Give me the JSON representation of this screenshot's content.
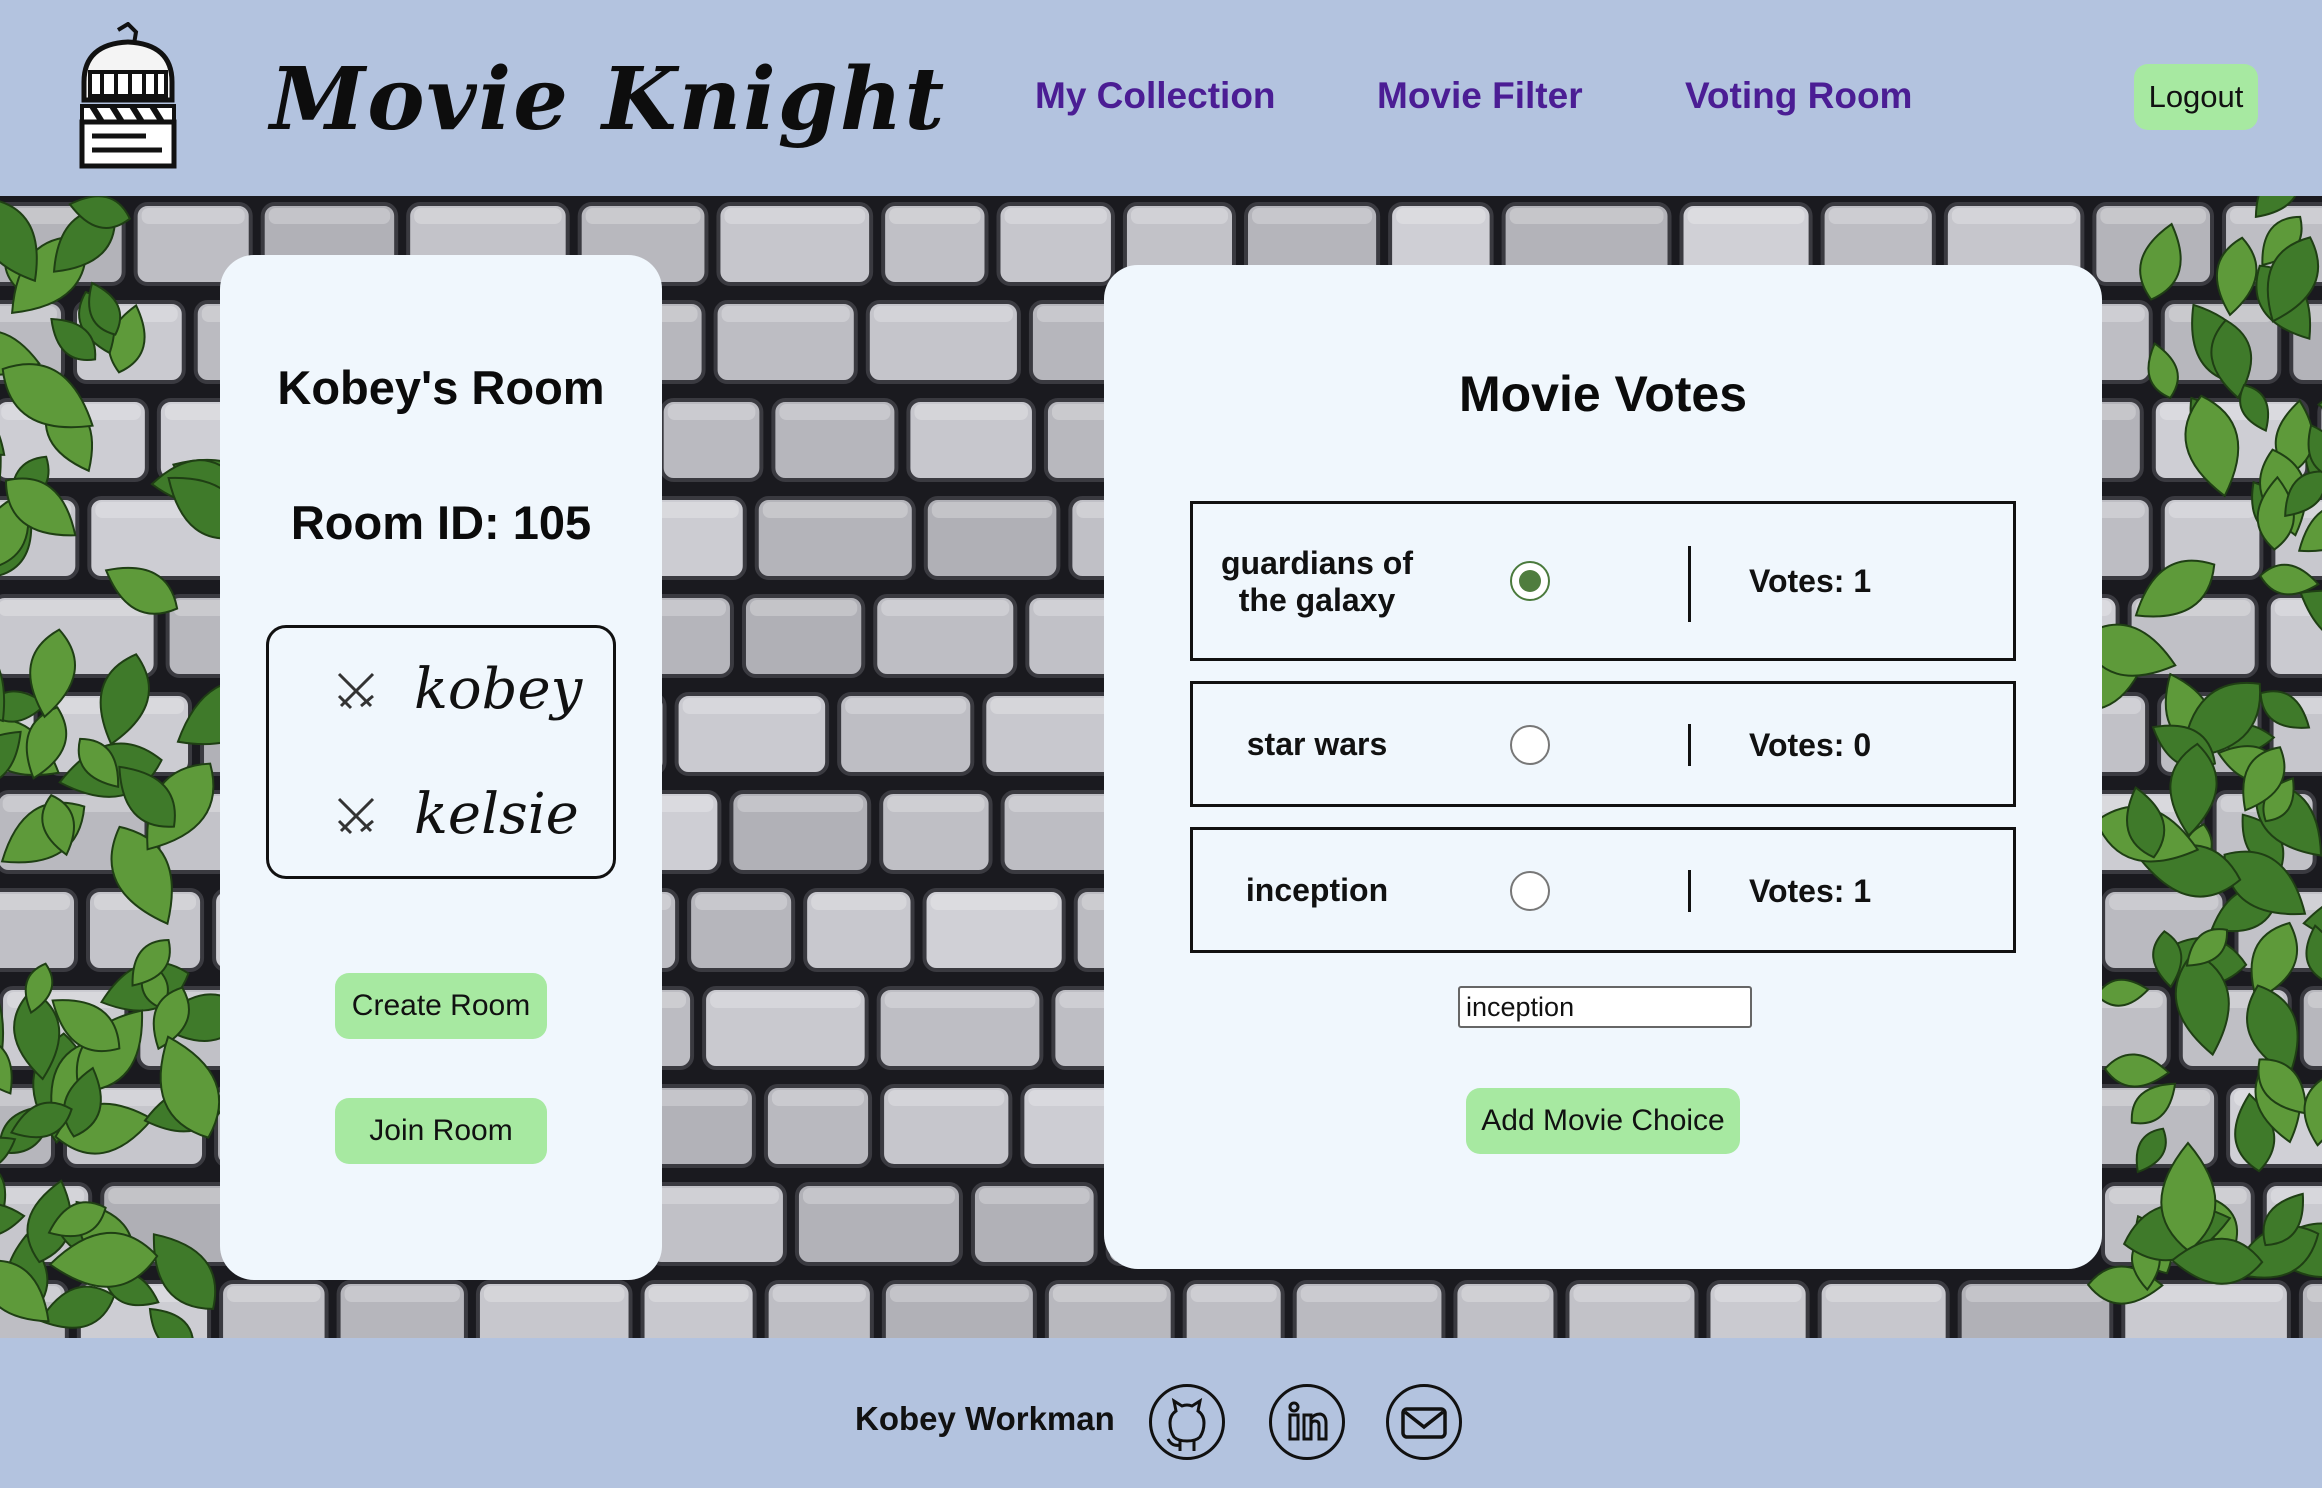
{
  "header": {
    "brand": "Movie Knight",
    "nav": [
      {
        "label": "My Collection"
      },
      {
        "label": "Movie Filter"
      },
      {
        "label": "Voting Room"
      }
    ],
    "logout_label": "Logout"
  },
  "room": {
    "title": "Kobey's Room",
    "room_id": "Room ID: 105",
    "members": [
      {
        "name": "kobey",
        "icon": "crossed-swords-icon"
      },
      {
        "name": "kelsie",
        "icon": "crossed-swords-icon"
      }
    ],
    "create_label": "Create Room",
    "join_label": "Join Room"
  },
  "votes": {
    "title": "Movie Votes",
    "choices": [
      {
        "name": "guardians of the galaxy",
        "selected": true,
        "votes_label": "Votes: 1"
      },
      {
        "name": "star wars",
        "selected": false,
        "votes_label": "Votes: 0"
      },
      {
        "name": "inception",
        "selected": false,
        "votes_label": "Votes: 1"
      }
    ],
    "input_value": "inception",
    "add_label": "Add Movie Choice"
  },
  "footer": {
    "name": "Kobey Workman",
    "links": [
      {
        "icon": "github-icon"
      },
      {
        "icon": "linkedin-icon"
      },
      {
        "icon": "mail-icon"
      }
    ]
  },
  "colors": {
    "header_bg": "#b3c3df",
    "nav_link": "#4b1d94",
    "button_green": "#a7e9a1",
    "card_bg": "#f0f7fd",
    "radio_selected": "#4f7d3e"
  }
}
